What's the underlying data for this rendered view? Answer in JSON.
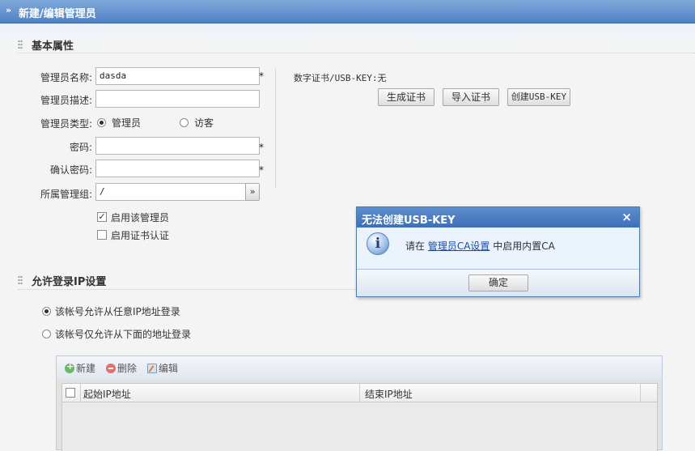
{
  "header": {
    "title": "新建/编辑管理员"
  },
  "basic": {
    "section_title": "基本属性",
    "name": {
      "label": "管理员名称:",
      "value": "dasda"
    },
    "desc": {
      "label": "管理员描述:",
      "value": ""
    },
    "type": {
      "label": "管理员类型:",
      "option_admin": "管理员",
      "option_guest": "访客",
      "selected": "管理员"
    },
    "password": {
      "label": "密码:",
      "value": ""
    },
    "confirm": {
      "label": "确认密码:",
      "value": ""
    },
    "group": {
      "label": "所属管理组:",
      "value": "/",
      "picker_glyph": "»"
    },
    "enable_admin": {
      "label": "启用该管理员",
      "checked": true
    },
    "enable_cert": {
      "label": "启用证书认证",
      "checked": false
    },
    "required_mark": "*",
    "cert": {
      "status": "数字证书/USB-KEY:无",
      "btn_generate": "生成证书",
      "btn_import": "导入证书",
      "btn_create_usbkey": "创建USB-KEY"
    }
  },
  "ip": {
    "section_title": "允许登录IP设置",
    "option_any": "该帐号允许从任意IP地址登录",
    "option_list": "该帐号仅允许从下面的地址登录",
    "selected": "any",
    "toolbar": {
      "add": "新建",
      "delete": "删除",
      "edit": "编辑"
    },
    "columns": [
      "起始IP地址",
      "结束IP地址"
    ],
    "rows": []
  },
  "dialog": {
    "title": "无法创建USB-KEY",
    "msg_prefix": "请在",
    "msg_link": "管理员CA设置",
    "msg_suffix": "中启用内置CA",
    "ok": "确定",
    "close_glyph": "×",
    "icon": "info-icon"
  },
  "colors": {
    "title_bar": "#4f81c3",
    "dialog_title": "#3e6fb6",
    "link": "#1b4ab0"
  }
}
